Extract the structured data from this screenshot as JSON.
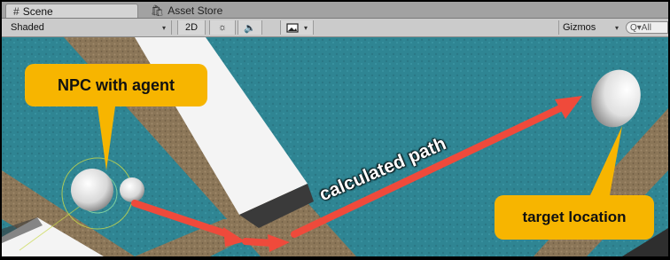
{
  "tabs": [
    {
      "label": "Scene",
      "icon": "hash-icon",
      "active": true
    },
    {
      "label": "Asset Store",
      "icon": "store-icon",
      "active": false
    }
  ],
  "toolbar": {
    "shading_mode": "Shaded",
    "mode_2d_label": "2D",
    "lighting_icon": "sun-icon",
    "audio_icon": "speaker-icon",
    "effects_icon": "image-icon",
    "gizmos_label": "Gizmos",
    "search_placeholder": "Q▾All"
  },
  "scene": {
    "npc_label": "NPC with agent",
    "path_label": "calculated path",
    "target_label": "target location",
    "colors": {
      "water": "#2f8593",
      "floor": "#8a7659",
      "white_block": "#f6f6f6",
      "callout": "#f7b500",
      "path_arrow": "#ef4a3b"
    }
  }
}
